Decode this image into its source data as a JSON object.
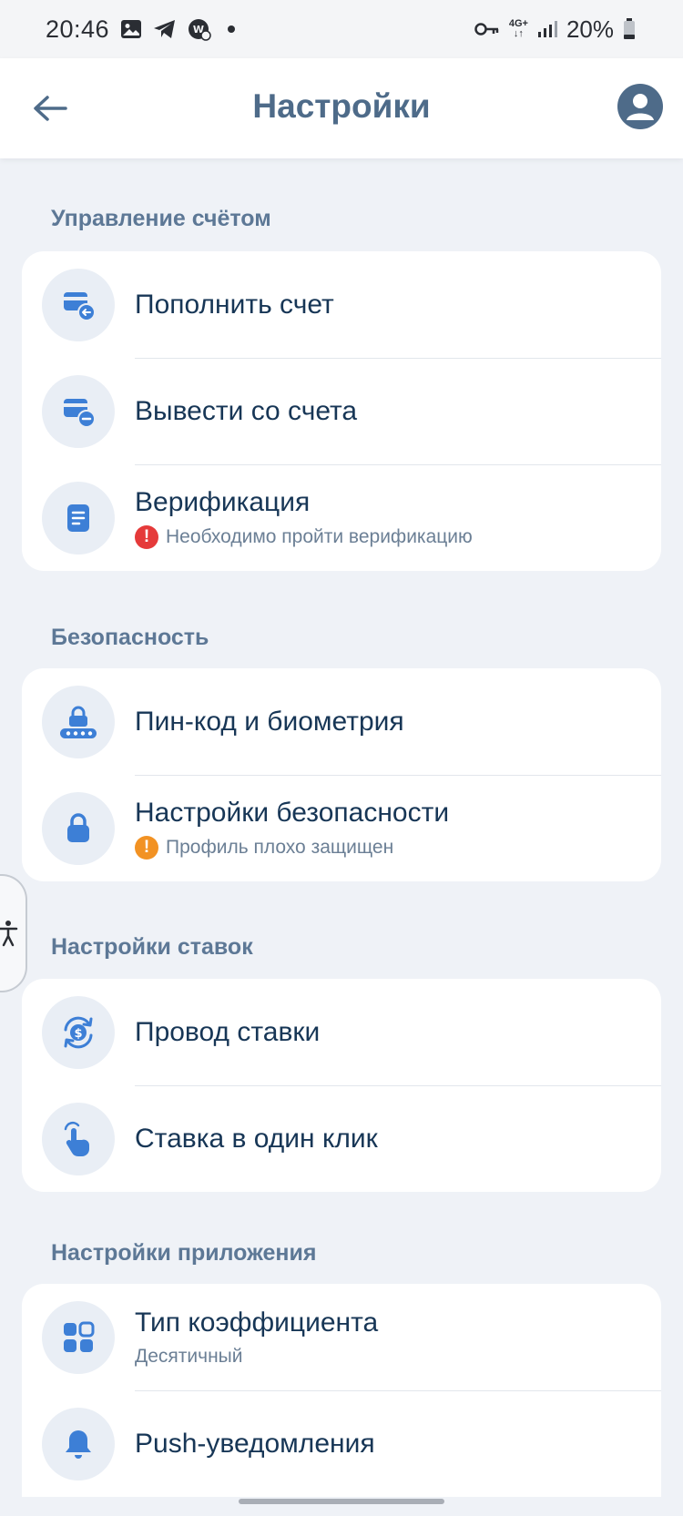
{
  "status_bar": {
    "time": "20:46",
    "network": "4G+",
    "battery": "20%",
    "icons": [
      "image-icon",
      "telegram-icon",
      "app-notification-icon",
      "dot-icon",
      "vpn-key-icon",
      "network-4g-icon",
      "signal-icon",
      "battery-icon"
    ]
  },
  "header": {
    "title": "Настройки",
    "back_icon": "arrow-left-icon",
    "profile_icon": "user-avatar-icon"
  },
  "colors": {
    "accent": "#3d7fd6",
    "title": "#4e6b89",
    "text": "#173656",
    "background": "#eff2f7",
    "error": "#e53a3a",
    "warning": "#f29223"
  },
  "sections": [
    {
      "title": "Управление счётом",
      "items": [
        {
          "label": "Пополнить счет",
          "icon": "card-deposit-icon"
        },
        {
          "label": "Вывести со счета",
          "icon": "card-withdraw-icon"
        },
        {
          "label": "Верификация",
          "subtitle": "Необходимо пройти верификацию",
          "badge": "!",
          "icon": "document-icon"
        }
      ]
    },
    {
      "title": "Безопасность",
      "items": [
        {
          "label": "Пин-код и биометрия",
          "icon": "pin-lock-icon"
        },
        {
          "label": "Настройки безопасности",
          "subtitle": "Профиль плохо защищен",
          "badge": "!",
          "icon": "lock-icon"
        }
      ]
    },
    {
      "title": "Настройки ставок",
      "items": [
        {
          "label": "Провод ставки",
          "icon": "money-cycle-icon"
        },
        {
          "label": "Ставка в один клик",
          "icon": "tap-hand-icon"
        }
      ]
    },
    {
      "title": "Настройки приложения",
      "items": [
        {
          "label": "Тип коэффициента",
          "subtitle": "Десятичный",
          "icon": "grid-icon"
        },
        {
          "label": "Push-уведомления",
          "icon": "bell-icon"
        }
      ]
    }
  ]
}
